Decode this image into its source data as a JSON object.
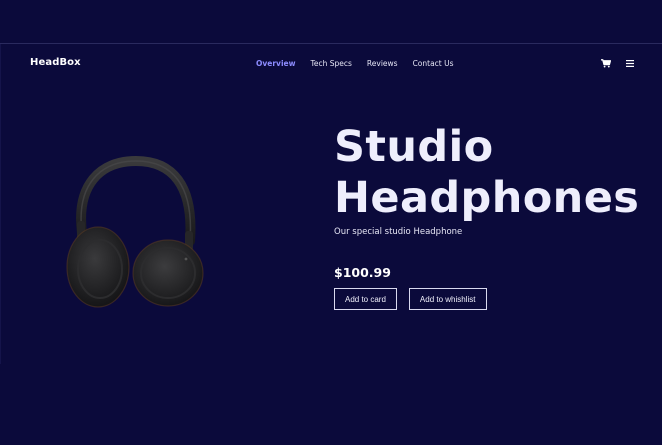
{
  "brand": "HeadBox",
  "nav": {
    "links": [
      "Overview",
      "Tech Specs",
      "Reviews",
      "Contact Us"
    ],
    "active": "Overview"
  },
  "icons": {
    "cart": "cart-icon",
    "menu": "menu-icon"
  },
  "product": {
    "title_line1": "Studio",
    "title_line2": "Headphones",
    "subtitle": "Our special studio Headphone",
    "price": "$100.99",
    "add_to_cart": "Add to card",
    "add_to_wishlist": "Add to whishlist"
  },
  "colors": {
    "background": "#0b0a3b",
    "accent": "#8d8cff",
    "text": "#eeeefc"
  }
}
